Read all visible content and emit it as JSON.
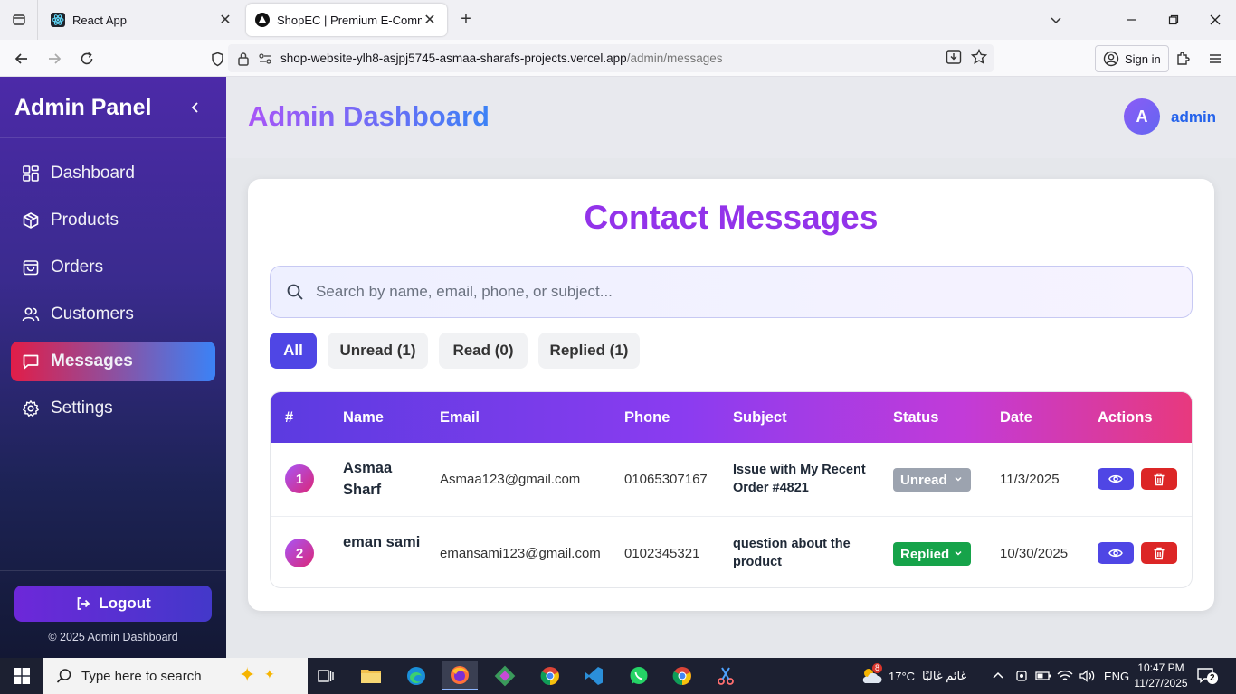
{
  "browser": {
    "tabs": [
      {
        "title": "React App"
      },
      {
        "title": "ShopEC | Premium E-Commerce"
      }
    ],
    "url_host": "shop-website-ylh8-asjpj5745-asmaa-sharafs-projects.vercel.app",
    "url_path": "/admin/messages",
    "signin_label": "Sign in"
  },
  "sidebar": {
    "title": "Admin Panel",
    "items": [
      {
        "label": "Dashboard",
        "icon": "grid-icon"
      },
      {
        "label": "Products",
        "icon": "box-icon"
      },
      {
        "label": "Orders",
        "icon": "bag-icon"
      },
      {
        "label": "Customers",
        "icon": "users-icon"
      },
      {
        "label": "Messages",
        "icon": "message-icon",
        "active": true
      },
      {
        "label": "Settings",
        "icon": "gear-icon"
      }
    ],
    "logout_label": "Logout",
    "copyright": "© 2025 Admin Dashboard"
  },
  "header": {
    "title": "Admin Dashboard",
    "avatar_letter": "A",
    "user_name": "admin"
  },
  "messages": {
    "title": "Contact Messages",
    "search_placeholder": "Search by name, email, phone, or subject...",
    "filters": [
      {
        "label": "All",
        "active": true
      },
      {
        "label": "Unread (1)"
      },
      {
        "label": "Read (0)"
      },
      {
        "label": "Replied (1)"
      }
    ],
    "columns": [
      "#",
      "Name",
      "Email",
      "Phone",
      "Subject",
      "Status",
      "Date",
      "Actions"
    ],
    "rows": [
      {
        "index": "1",
        "name": "Asmaa Sharf",
        "email": "Asmaa123@gmail.com",
        "phone": "01065307167",
        "subject": "Issue with My Recent Order #4821",
        "status": "Unread",
        "status_color": "#9ca3af",
        "date": "11/3/2025"
      },
      {
        "index": "2",
        "name": "eman sami",
        "email": "emansami123@gmail.com",
        "phone": "0102345321",
        "subject": "question about the product",
        "status": "Replied",
        "status_color": "#16a34a",
        "date": "10/30/2025"
      }
    ]
  },
  "colors": {
    "accent": "#4f46e5",
    "title_purple": "#9333ea",
    "delete_red": "#dc2626",
    "view_blue": "#4f46e5"
  },
  "taskbar": {
    "search_placeholder": "Type here to search",
    "weather": "17°C",
    "weather_text": "غائم غالبًا",
    "language": "ENG",
    "time": "10:47 PM",
    "date": "11/27/2025",
    "notifications": "2",
    "weather_badge": "8"
  }
}
